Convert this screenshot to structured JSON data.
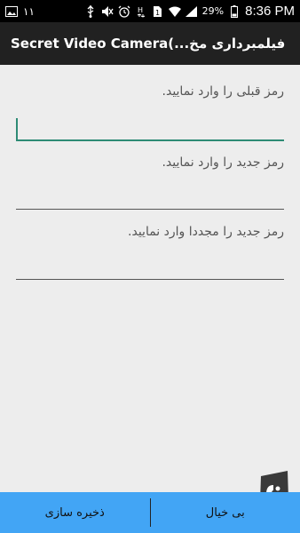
{
  "status_bar": {
    "notification_count": "١١",
    "battery_percent": "29%",
    "time": "8:36 PM",
    "icons": [
      "image-icon",
      "usb-icon",
      "mute-icon",
      "alarm-icon",
      "hd-icon",
      "sim-icon",
      "wifi-icon",
      "signal-icon",
      "battery-icon"
    ]
  },
  "app_bar": {
    "title": "Secret Video Camera(...فیلمبرداری مخ"
  },
  "form": {
    "old_password_label": "رمز قبلی را وارد نمایید.",
    "old_password_value": "",
    "new_password_label": "رمز جدید را وارد نمایید.",
    "new_password_value": "",
    "confirm_password_label": "رمز جدید را مجددا وارد نمایید.",
    "confirm_password_value": ""
  },
  "bottom_bar": {
    "save_label": "ذخیره سازی",
    "cancel_label": "بی خیال"
  },
  "colors": {
    "accent": "#2e8b75",
    "bottom_bar": "#42a5f5",
    "app_bar": "#212121",
    "background": "#ededed"
  }
}
